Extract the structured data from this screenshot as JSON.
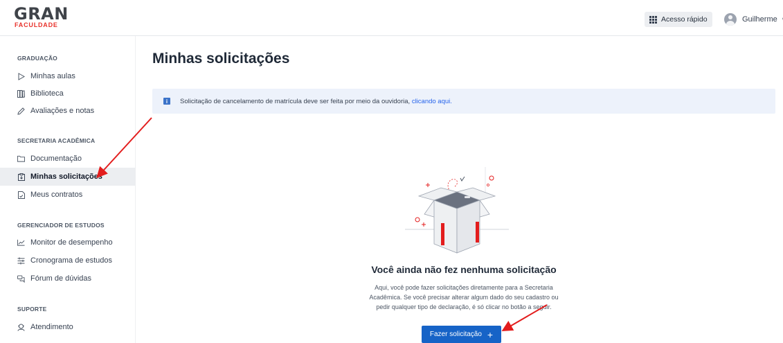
{
  "brand": {
    "name": "GRAN",
    "sub": "FACULDADE",
    "accent": "#e8322b"
  },
  "header": {
    "quick_access": "Acesso rápido",
    "user_name": "Guilherme"
  },
  "sidebar": {
    "sections": [
      {
        "title": "GRADUAÇÃO",
        "items": [
          {
            "label": "Minhas aulas",
            "icon": "play-outline-icon"
          },
          {
            "label": "Biblioteca",
            "icon": "library-icon"
          },
          {
            "label": "Avaliações e notas",
            "icon": "pencil-icon"
          }
        ]
      },
      {
        "title": "SECRETARIA ACADÊMICA",
        "items": [
          {
            "label": "Documentação",
            "icon": "folder-icon"
          },
          {
            "label": "Minhas solicitações",
            "icon": "clipboard-icon",
            "active": true
          },
          {
            "label": "Meus contratos",
            "icon": "document-icon"
          }
        ]
      },
      {
        "title": "GERENCIADOR DE ESTUDOS",
        "items": [
          {
            "label": "Monitor de desempenho",
            "icon": "chart-line-icon"
          },
          {
            "label": "Cronograma de estudos",
            "icon": "schedule-icon"
          },
          {
            "label": "Fórum de dúvidas",
            "icon": "chat-icon"
          }
        ]
      },
      {
        "title": "SUPORTE",
        "items": [
          {
            "label": "Atendimento",
            "icon": "headset-icon"
          }
        ]
      }
    ]
  },
  "main": {
    "title": "Minhas solicitações",
    "info": {
      "text": "Solicitação de cancelamento de matrícula deve ser feita por meio da ouvidoria,",
      "link": "clicando aqui."
    },
    "empty": {
      "title": "Você ainda não fez nenhuma solicitação",
      "desc_1": "Aqui, você pode fazer solicitações diretamente para a Secretaria",
      "desc_2": "Acadêmica. Se você precisar alterar algum dado do seu cadastro ou",
      "desc_3": "pedir qualquer tipo de declaração, é só clicar no botão a seguir."
    },
    "cta": "Fazer solicitação"
  },
  "colors": {
    "primary": "#1663c7",
    "info_bg": "#edf2fb",
    "arrow": "#e31d1d"
  }
}
